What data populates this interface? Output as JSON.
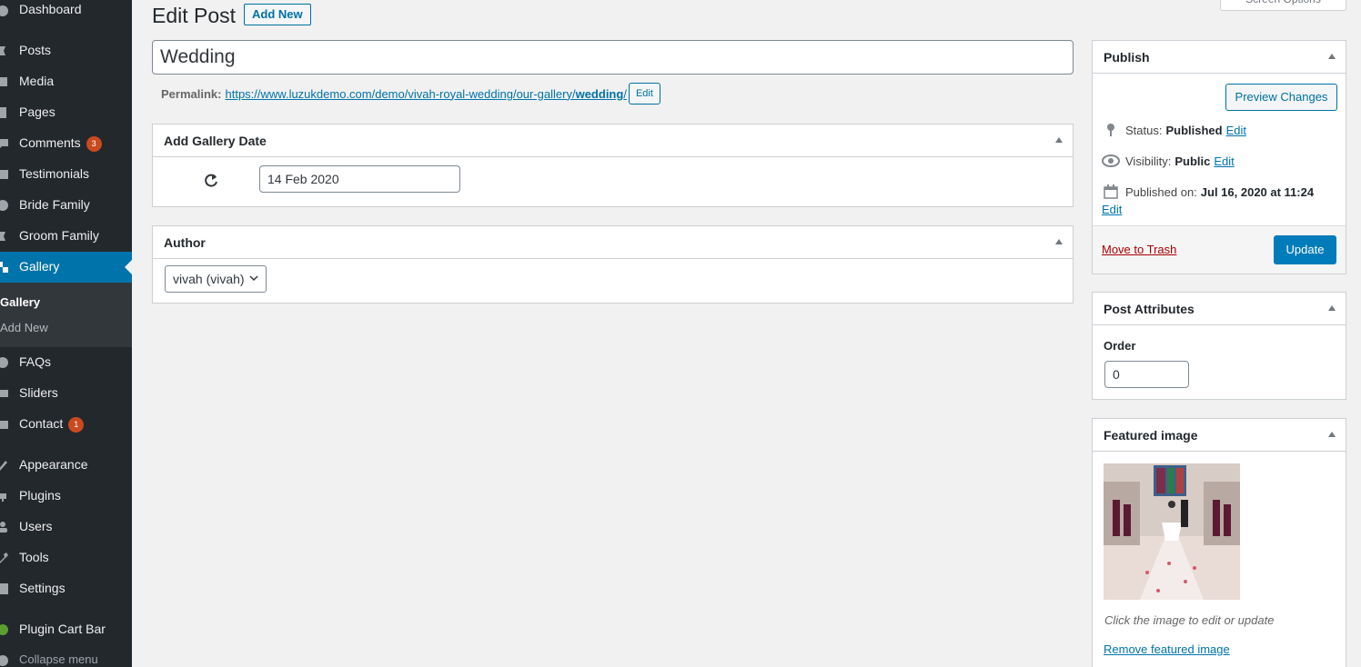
{
  "sidebar": {
    "items": [
      {
        "label": "Dashboard",
        "icon": "dashboard-icon"
      },
      {
        "label": "Posts",
        "icon": "pin-icon"
      },
      {
        "label": "Media",
        "icon": "media-icon"
      },
      {
        "label": "Pages",
        "icon": "page-icon"
      },
      {
        "label": "Comments",
        "icon": "comment-icon",
        "badge": "3"
      },
      {
        "label": "Testimonials",
        "icon": "quote-icon"
      },
      {
        "label": "Bride Family",
        "icon": "admin-post-icon"
      },
      {
        "label": "Groom Family",
        "icon": "admin-post-icon"
      },
      {
        "label": "Gallery",
        "icon": "gallery-icon",
        "active": true
      },
      {
        "label": "FAQs",
        "icon": "chat-icon"
      },
      {
        "label": "Sliders",
        "icon": "slides-icon"
      },
      {
        "label": "Contact",
        "icon": "mail-icon",
        "badge": "1"
      },
      {
        "label": "Appearance",
        "icon": "brush-icon"
      },
      {
        "label": "Plugins",
        "icon": "plug-icon"
      },
      {
        "label": "Users",
        "icon": "users-icon"
      },
      {
        "label": "Tools",
        "icon": "wrench-icon"
      },
      {
        "label": "Settings",
        "icon": "settings-icon"
      },
      {
        "label": "Plugin Cart Bar",
        "icon": "leaf-icon"
      },
      {
        "label": "Collapse menu",
        "icon": "collapse-icon"
      }
    ],
    "submenu": [
      {
        "label": "Gallery",
        "current": true
      },
      {
        "label": "Add New"
      }
    ]
  },
  "header": {
    "title": "Edit Post",
    "add_new_label": "Add New",
    "screen_options_label": "Screen Options"
  },
  "post": {
    "title": "Wedding",
    "permalink_label": "Permalink:",
    "permalink_base": "https://www.luzukdemo.com/demo/vivah-royal-wedding/our-gallery/",
    "permalink_slug": "wedding",
    "permalink_trailing": "/",
    "permalink_edit_label": "Edit"
  },
  "gallery_date_box": {
    "title": "Add Gallery Date",
    "date_value": "14 Feb 2020"
  },
  "author_box": {
    "title": "Author",
    "selected": "vivah (vivah)"
  },
  "publish_box": {
    "title": "Publish",
    "preview_label": "Preview Changes",
    "status_label": "Status:",
    "status_value": "Published",
    "visibility_label": "Visibility:",
    "visibility_value": "Public",
    "published_on_label": "Published on:",
    "published_on_value": "Jul 16, 2020 at 11:24",
    "edit_label": "Edit",
    "trash_label": "Move to Trash",
    "update_label": "Update"
  },
  "attributes_box": {
    "title": "Post Attributes",
    "order_label": "Order",
    "order_value": "0"
  },
  "featured_box": {
    "title": "Featured image",
    "caption": "Click the image to edit or update",
    "remove_label": "Remove featured image"
  },
  "colors": {
    "sidebar_bg": "#23282d",
    "active_bg": "#0073aa",
    "badge": "#ca4a1f",
    "primary_button": "#007cba",
    "link": "#0073aa",
    "trash_link": "#aa0000"
  }
}
